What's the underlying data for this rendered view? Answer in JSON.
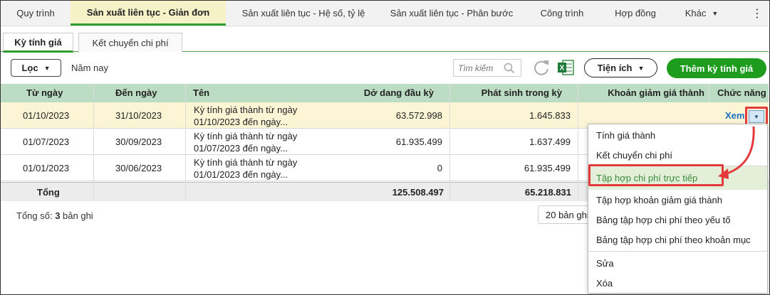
{
  "top_tabs": [
    {
      "label": "Quy trình"
    },
    {
      "label": "Sản xuất liên tục - Giản đơn"
    },
    {
      "label": "Sản xuất liên tục - Hệ số, tỷ lệ"
    },
    {
      "label": "Sản xuất liên tục - Phân bước"
    },
    {
      "label": "Công trình"
    },
    {
      "label": "Hợp đồng"
    },
    {
      "label": "Khác"
    }
  ],
  "sub_tabs": [
    {
      "label": "Kỳ tính giá"
    },
    {
      "label": "Kết chuyển chi phí"
    }
  ],
  "toolbar": {
    "filter_label": "Lọc",
    "filter_value": "Năm nay",
    "search_placeholder": "Tìm kiếm",
    "utilities_label": "Tiện ích",
    "add_label": "Thêm kỳ tính giá"
  },
  "columns": [
    "Từ ngày",
    "Đến ngày",
    "Tên",
    "Dở dang đầu kỳ",
    "Phát sinh trong kỳ",
    "Khoản giảm giá thành",
    "Chức năng"
  ],
  "rows": [
    {
      "from": "01/10/2023",
      "to": "31/10/2023",
      "name_line1": "Kỳ tính giá thành từ ngày",
      "name_line2": "01/10/2023 đến ngày...",
      "opening": "63.572.998",
      "incurred": "1.645.833",
      "reduction": "",
      "action": "Xem"
    },
    {
      "from": "01/07/2023",
      "to": "30/09/2023",
      "name_line1": "Kỳ tính giá thành từ ngày",
      "name_line2": "01/07/2023 đến ngày...",
      "opening": "61.935.499",
      "incurred": "1.637.499",
      "reduction": ""
    },
    {
      "from": "01/01/2023",
      "to": "30/06/2023",
      "name_line1": "Kỳ tính giá thành từ ngày",
      "name_line2": "01/01/2023 đến ngày...",
      "opening": "0",
      "incurred": "61.935.499",
      "reduction": ""
    }
  ],
  "total": {
    "label": "Tổng",
    "opening": "125.508.497",
    "incurred": "65.218.831"
  },
  "footer": {
    "count_prefix": "Tổng số: ",
    "count": "3",
    "count_suffix": " bản ghi",
    "page_size": "20 bản ghi"
  },
  "menu": {
    "items": [
      {
        "label": "Tính giá thành"
      },
      {
        "label": "Kết chuyển chi phí"
      },
      {
        "label": "Tập hợp chi phí trực tiếp",
        "highlighted": true
      },
      {
        "label": "Tập hợp khoản giảm giá thành"
      },
      {
        "label": "Bảng tập hợp chi phí theo yếu tố"
      },
      {
        "label": "Bảng tập hợp chi phí theo khoản mục"
      },
      {
        "label": "Sửa"
      },
      {
        "label": "Xóa"
      }
    ]
  },
  "colors": {
    "accent": "#1e9c1e",
    "header_bg": "#bddcc4",
    "selected_row": "#fbf5d6",
    "highlight": "#e33b3b",
    "link": "#1a6fc2"
  }
}
